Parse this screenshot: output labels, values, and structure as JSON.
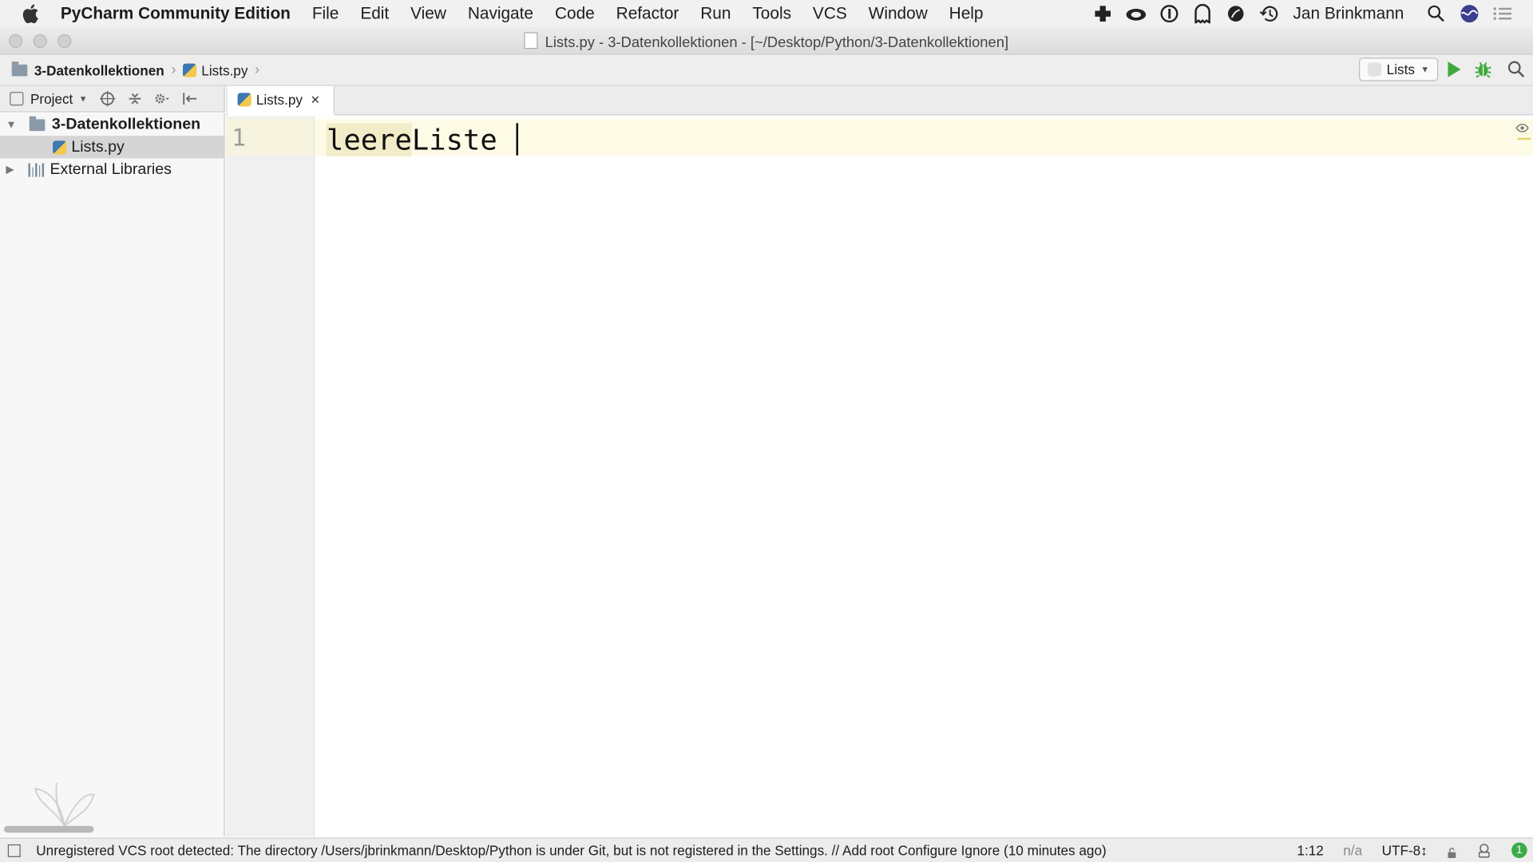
{
  "menubar": {
    "app_name": "PyCharm Community Edition",
    "items": [
      "File",
      "Edit",
      "View",
      "Navigate",
      "Code",
      "Refactor",
      "Run",
      "Tools",
      "VCS",
      "Window",
      "Help"
    ],
    "user_name": "Jan Brinkmann"
  },
  "window": {
    "title": "Lists.py - 3-Datenkollektionen - [~/Desktop/Python/3-Datenkollektionen]"
  },
  "navbar": {
    "breadcrumb_folder": "3-Datenkollektionen",
    "breadcrumb_file": "Lists.py",
    "run_config": "Lists"
  },
  "project_panel": {
    "view_label": "Project",
    "tree": {
      "root": "3-Datenkollektionen",
      "file": "Lists.py",
      "libraries": "External Libraries"
    }
  },
  "editor": {
    "tab_label": "Lists.py",
    "line_number": "1",
    "code_highlighted": "leere",
    "code_rest": "Liste "
  },
  "statusbar": {
    "message": "Unregistered VCS root detected: The directory /Users/jbrinkmann/Desktop/Python is under Git, but is not registered in the Settings. // Add root  Configure  Ignore (10 minutes ago)",
    "position": "1:12",
    "na": "n/a",
    "encoding": "UTF-8↕",
    "event_count": "1"
  },
  "colors": {
    "run_green": "#3eaa3e",
    "current_line": "#fdfbe6",
    "event_badge": "#3dab4b"
  }
}
